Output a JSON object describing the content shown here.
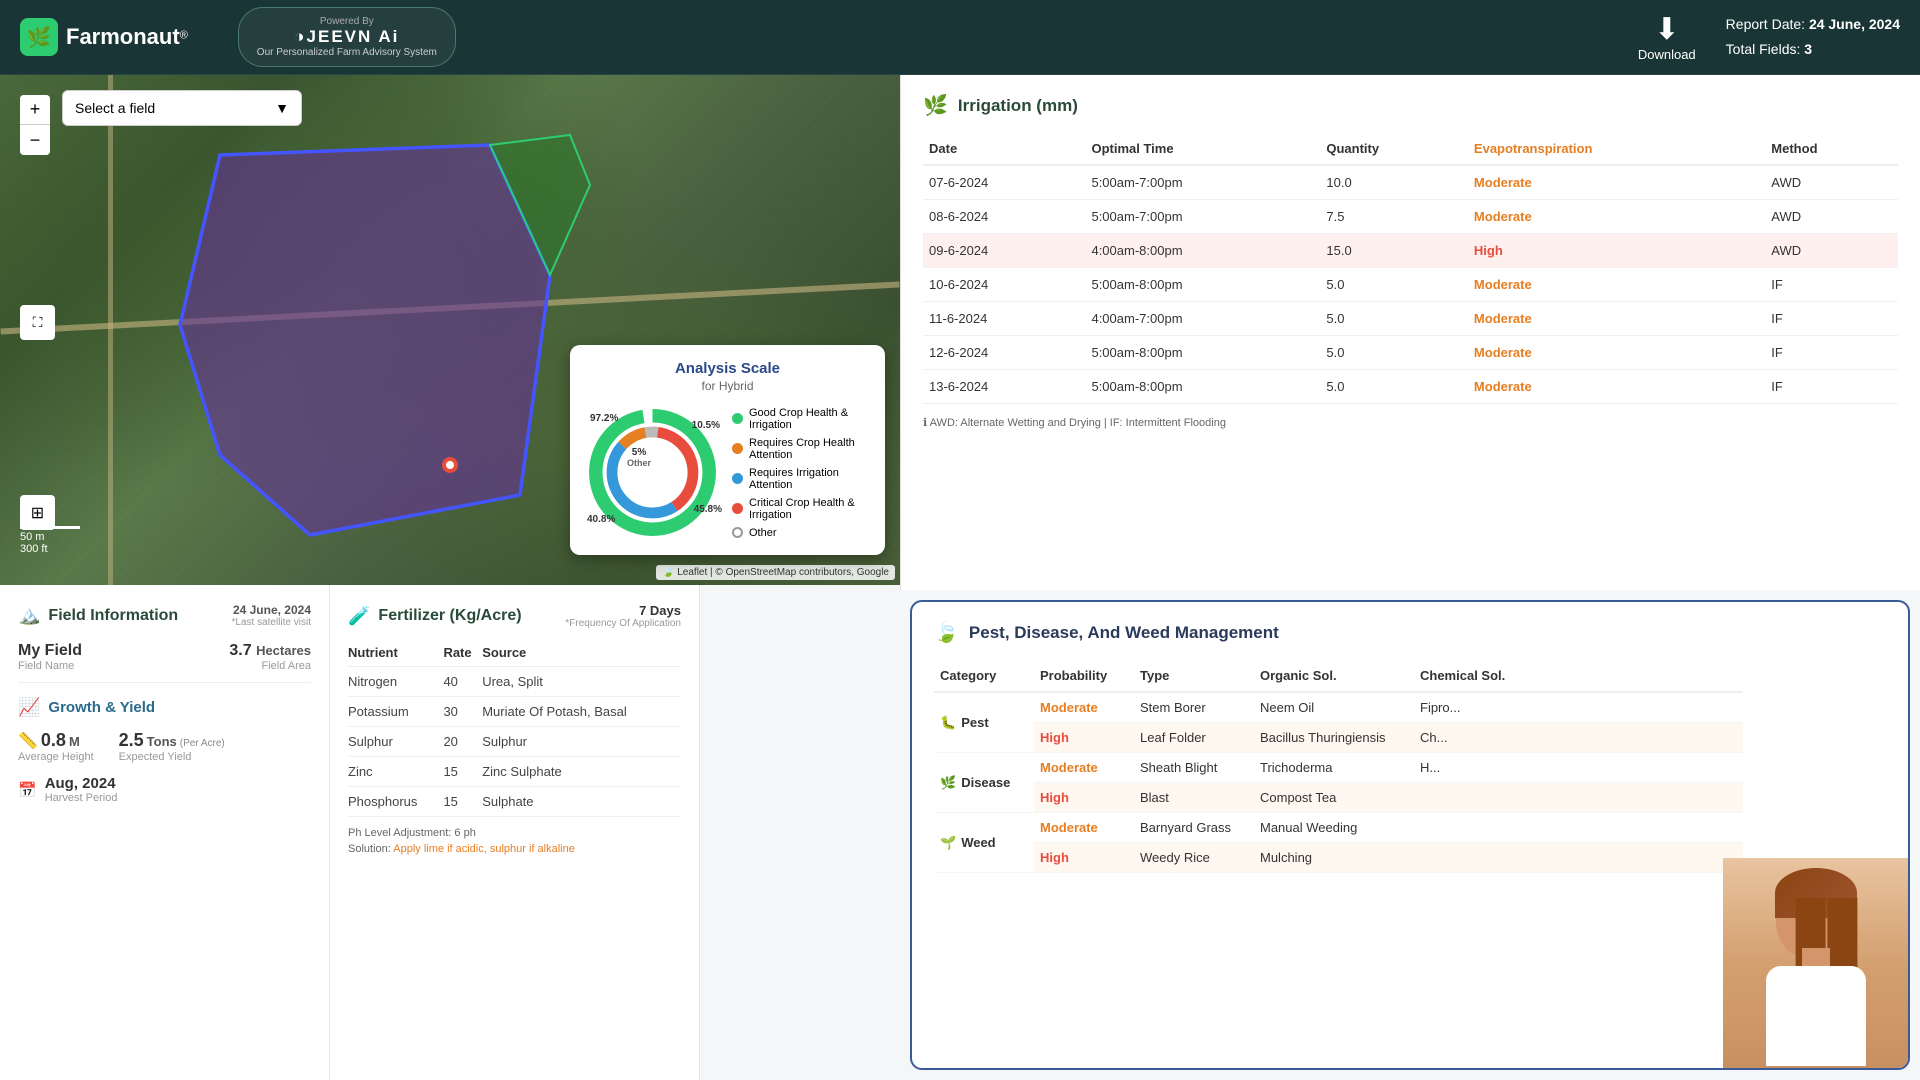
{
  "header": {
    "logo_text": "Farmonaut",
    "logo_reg": "®",
    "jeevn_name": "◑JEEVN Ai",
    "jeevn_powered": "Powered By",
    "jeevn_sub": "Our Personalized Farm Advisory System",
    "download_label": "Download",
    "report_date_label": "Report Date:",
    "report_date_val": "24 June, 2024",
    "total_fields_label": "Total Fields:",
    "total_fields_val": "3"
  },
  "map": {
    "field_select_placeholder": "Select a field",
    "zoom_in": "+",
    "zoom_out": "−",
    "scale_m": "50 m",
    "scale_ft": "300 ft",
    "attribution": "🍃 Leaflet | © OpenStreetMap contributors, Google"
  },
  "analysis_scale": {
    "title": "Analysis Scale",
    "subtitle": "for Hybrid",
    "pct_97": "97.2%",
    "pct_10": "10.5%",
    "pct_45": "45.8%",
    "pct_40": "40.8%",
    "pct_5": "5%",
    "pct_5_label": "Other",
    "legend": [
      {
        "label": "Good Crop Health & Irrigation",
        "color": "#2ecc71"
      },
      {
        "label": "Requires Crop Health Attention",
        "color": "#e67e22"
      },
      {
        "label": "Requires Irrigation Attention",
        "color": "#3498db"
      },
      {
        "label": "Critical Crop Health & Irrigation",
        "color": "#e74c3c"
      },
      {
        "label": "Other",
        "color": "transparent",
        "border": "#999"
      }
    ]
  },
  "field_info": {
    "title": "Field Information",
    "date": "24 June, 2024",
    "last_visit": "*Last satellite visit",
    "field_name": "My Field",
    "field_name_label": "Field Name",
    "field_area": "3.7 Hectares",
    "field_area_label": "Field Area",
    "growth_title": "Growth & Yield",
    "height_val": "0.8",
    "height_unit": "M",
    "height_label": "Average Height",
    "yield_val": "2.5",
    "yield_unit": "Tons",
    "yield_per": "(Per Acre)",
    "yield_label": "Expected Yield",
    "harvest_date": "Aug, 2024",
    "harvest_label": "Harvest Period"
  },
  "fertilizer": {
    "title": "Fertilizer (Kg/Acre)",
    "days": "7 Days",
    "freq_label": "*Frequency Of Application",
    "headers": [
      "Nutrient",
      "Rate",
      "Source"
    ],
    "rows": [
      {
        "nutrient": "Nitrogen",
        "rate": "40",
        "source": "Urea, Split"
      },
      {
        "nutrient": "Potassium",
        "rate": "30",
        "source": "Muriate Of Potash, Basal"
      },
      {
        "nutrient": "Sulphur",
        "rate": "20",
        "source": "Sulphur"
      },
      {
        "nutrient": "Zinc",
        "rate": "15",
        "source": "Zinc Sulphate"
      },
      {
        "nutrient": "Phosphorus",
        "rate": "15",
        "source": "Sulphate"
      }
    ],
    "ph_note": "Ph Level Adjustment: 6 ph",
    "solution": "Solution: Apply lime if acidic, sulphur if alkaline"
  },
  "irrigation": {
    "title": "Irrigation (mm)",
    "headers": [
      "Date",
      "Optimal Time",
      "Quantity",
      "Evapotranspiration",
      "Method"
    ],
    "rows": [
      {
        "date": "07-6-2024",
        "time": "5:00am-7:00pm",
        "qty": "10.0",
        "evap": "Moderate",
        "method": "AWD",
        "highlight": false
      },
      {
        "date": "08-6-2024",
        "time": "5:00am-7:00pm",
        "qty": "7.5",
        "evap": "Moderate",
        "method": "AWD",
        "highlight": false
      },
      {
        "date": "09-6-2024",
        "time": "4:00am-8:00pm",
        "qty": "15.0",
        "evap": "High",
        "method": "AWD",
        "highlight": true
      },
      {
        "date": "10-6-2024",
        "time": "5:00am-8:00pm",
        "qty": "5.0",
        "evap": "Moderate",
        "method": "IF",
        "highlight": false
      },
      {
        "date": "11-6-2024",
        "time": "4:00am-7:00pm",
        "qty": "5.0",
        "evap": "Moderate",
        "method": "IF",
        "highlight": false
      },
      {
        "date": "12-6-2024",
        "time": "5:00am-8:00pm",
        "qty": "5.0",
        "evap": "Moderate",
        "method": "IF",
        "highlight": false
      },
      {
        "date": "13-6-2024",
        "time": "5:00am-8:00pm",
        "qty": "5.0",
        "evap": "Moderate",
        "method": "IF",
        "highlight": false
      }
    ],
    "notes": "ℹ AWD: Alternate Wetting and Drying | IF: Intermittent Flooding"
  },
  "pest": {
    "title": "Pest, Disease, And Weed Management",
    "headers": [
      "Category",
      "Probability",
      "Type",
      "Organic Sol.",
      "Chemical Sol."
    ],
    "rows": [
      {
        "category": "Pest",
        "cat_icon": "🐛",
        "probability": "Moderate",
        "type": "Stem Borer",
        "organic": "Neem Oil",
        "chemical": "Fipro...",
        "prob_class": "moderate",
        "rowspan": false
      },
      {
        "category": "",
        "cat_icon": "",
        "probability": "High",
        "type": "Leaf Folder",
        "organic": "Bacillus Thuringiensis",
        "chemical": "Ch...",
        "prob_class": "high",
        "rowspan": true
      },
      {
        "category": "Disease",
        "cat_icon": "🌿",
        "probability": "Moderate",
        "type": "Sheath Blight",
        "organic": "Trichoderma",
        "chemical": "H...",
        "prob_class": "moderate",
        "rowspan": false
      },
      {
        "category": "",
        "cat_icon": "",
        "probability": "High",
        "type": "Blast",
        "organic": "Compost Tea",
        "chemical": "",
        "prob_class": "high",
        "rowspan": true
      },
      {
        "category": "Weed",
        "cat_icon": "🌱",
        "probability": "Moderate",
        "type": "Barnyard Grass",
        "organic": "Manual Weeding",
        "chemical": "",
        "prob_class": "moderate",
        "rowspan": false
      },
      {
        "category": "",
        "cat_icon": "",
        "probability": "High",
        "type": "Weedy Rice",
        "organic": "Mulching",
        "chemical": "",
        "prob_class": "high",
        "rowspan": true
      }
    ]
  }
}
